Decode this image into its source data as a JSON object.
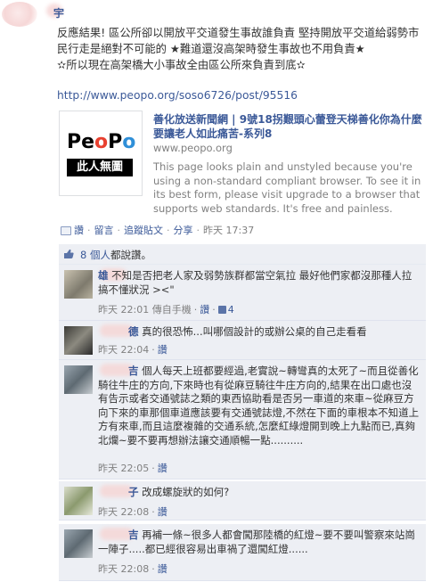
{
  "post": {
    "author_name": "宇",
    "text": "反應結果! 區公所卻以開放平交道發生事故誰負責 堅持開放平交道給弱勢市民行走是絕對不可能的 ★難道還沒高架時發生事故也不用負責★\n✫所以現在高架橋大小事故全由區公所來負責到底✫",
    "link": "http://www.peopo.org/soso6726/post/95516"
  },
  "attachment": {
    "logo_text": "PeoPo",
    "logo_sub": "此人無圖",
    "title": "善化放送新聞網 | 9號18拐艱頭心蕾登天梯善化你為什麼要讓老人如此痛苦-系列8",
    "domain": "www.peopo.org",
    "description": "This page looks plain and unstyled because you're using a non-standard compliant browser. To see it in its best form, please visit upgrade to a browser that supports web standards. It's free and painless."
  },
  "actions": {
    "like": "讚",
    "comment": "留言",
    "unfollow": "追蹤貼文",
    "share": "分享",
    "time": "昨天 17:37"
  },
  "likes": {
    "count_link": "8 個人",
    "suffix": "都說讚。"
  },
  "comments": [
    {
      "name": "雄",
      "text": "不知是否把老人家及弱勢族群都當空氣拉 最好他們家都沒那種人拉 搞不懂狀況 ><\"",
      "time": "昨天 22:01 傳自手機",
      "like": "讚",
      "like_count": "4"
    },
    {
      "name": "德",
      "text": "真的很恐怖...叫哪個設計的或辦公桌的自己走看看",
      "time": "昨天 22:04",
      "like": "讚"
    },
    {
      "name": "吉",
      "text": "個人每天上班都要經過,老實說~轉彎真的太死了~而且從善化騎往牛庄的方向,下來時也有從麻豆騎往牛庄方向的,結果在出口處也沒有告示或者交通號誌之類的東西協助看是否另一車道的來車~從麻豆方向下來的車那個車道應該要有交通號誌燈,不然在下面的車根本不知道上方有來車,而且這麼複雜的交通系統,怎麼紅綠燈開到晚上九點而已,真夠北爛~要不要再想辦法讓交通順暢一點..........",
      "time": "昨天 22:05",
      "like": "讚"
    },
    {
      "name": "子",
      "text": "改成螺旋狀的如何?",
      "time": "昨天 22:08",
      "like": "讚"
    },
    {
      "name": "吉",
      "text": "再補一條~很多人都會闖那陸橋的紅燈~要不要叫警察來站崗一陣子.....都已經很容易出車禍了還闖紅燈......",
      "time": "昨天 22:08",
      "like": "讚"
    }
  ]
}
